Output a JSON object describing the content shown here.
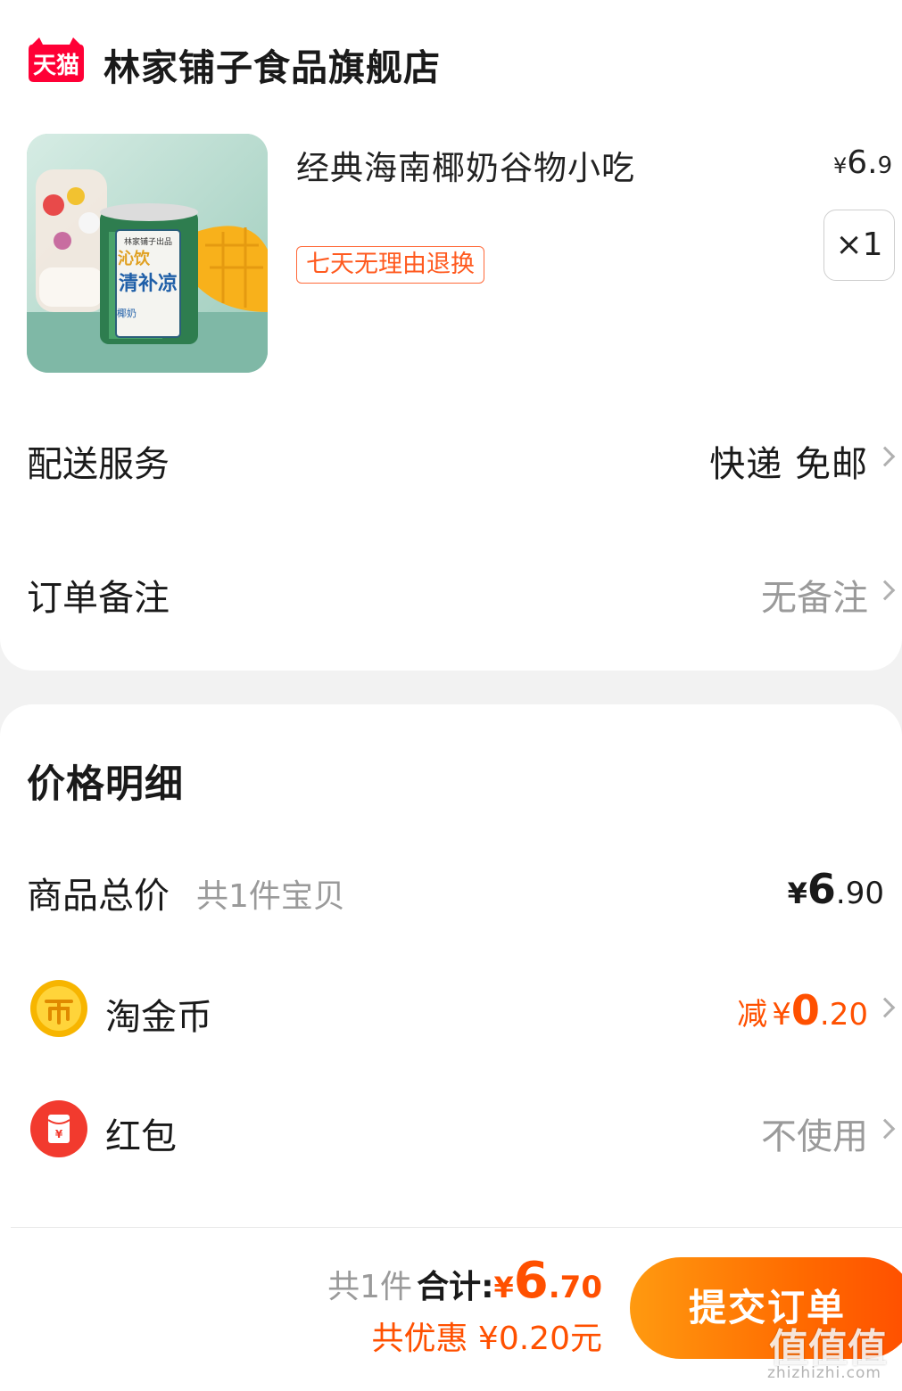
{
  "store": {
    "logo_text": "天猫",
    "name": "林家铺子食品旗舰店"
  },
  "product": {
    "title": "经典海南椰奶谷物小吃",
    "price_yen": "¥",
    "price_int": "6.",
    "price_dec": "9",
    "tag": "七天无理由退换",
    "quantity": "×1",
    "image_label_brand": "沁饮",
    "image_label_name": "清补凉",
    "image_label_maker": "林家铺子出品",
    "image_label_sub": "椰奶"
  },
  "delivery": {
    "label": "配送服务",
    "value": "快递 免邮"
  },
  "remark": {
    "label": "订单备注",
    "value": "无备注"
  },
  "price_detail": {
    "title": "价格明细",
    "goods_total_label": "商品总价",
    "goods_count": "共1件宝贝",
    "goods_total_yen": "¥",
    "goods_total_int": "6",
    "goods_total_dec": ".90",
    "coins_label": "淘金币",
    "coins_prefix": "减",
    "coins_yen": "¥",
    "coins_int": "0",
    "coins_dec": ".20",
    "redpacket_label": "红包",
    "redpacket_value": "不使用"
  },
  "footer": {
    "count": "共1件",
    "total_label": "合计:",
    "total_yen": "¥",
    "total_int": "6",
    "total_dec": ".70",
    "discount": "共优惠 ¥0.20元",
    "submit": "提交订单"
  },
  "watermark": {
    "main": "值值值",
    "sub": "zhizhizhi.com"
  },
  "colors": {
    "accent": "#ff5000",
    "tmall_red": "#ff0036"
  }
}
